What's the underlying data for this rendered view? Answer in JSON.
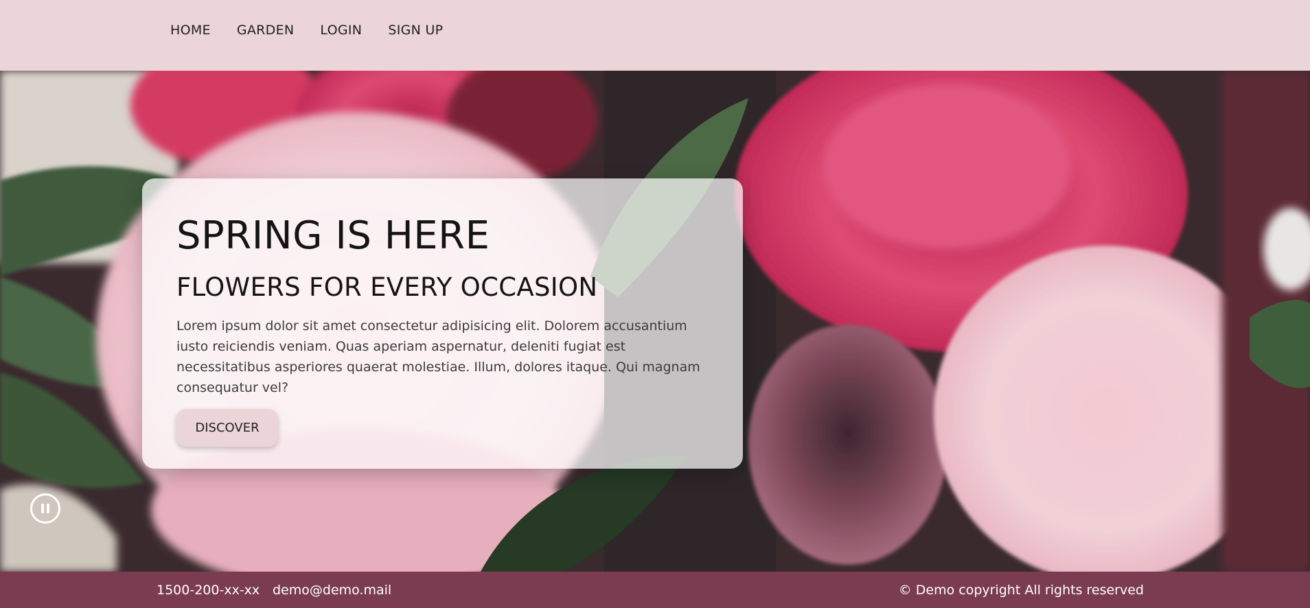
{
  "nav": {
    "items": [
      {
        "label": "HOME"
      },
      {
        "label": "GARDEN"
      },
      {
        "label": "LOGIN"
      },
      {
        "label": "SIGN UP"
      }
    ]
  },
  "hero": {
    "image": "peony-bouquet-background",
    "title": "SPRING IS HERE",
    "subtitle": "FLOWERS FOR EVERY OCCASION",
    "body": "Lorem ipsum dolor sit amet consectetur adipisicing elit. Dolorem accusantium iusto reiciendis veniam. Quas aperiam aspernatur, deleniti fugiat est necessitatibus asperiores quaerat molestiae. Illum, dolores itaque. Qui magnam consequatur vel?",
    "button_label": "DISCOVER",
    "media_control_icon": "pause-icon"
  },
  "footer": {
    "phone": "1500-200-xx-xx",
    "email": "demo@demo.mail",
    "copyright": "© Demo copyright All rights reserved"
  },
  "colors": {
    "header_bg": "#ecd5d9",
    "footer_bg": "#7b3c52",
    "button_bg": "#ecd5d9",
    "text_dark": "#141414"
  }
}
